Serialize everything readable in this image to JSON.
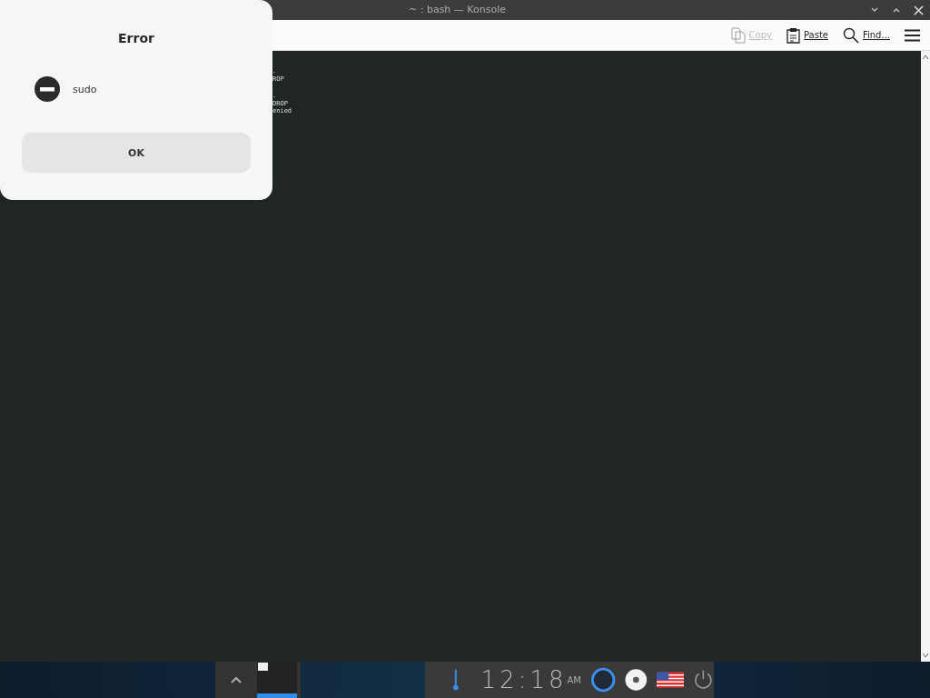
{
  "window": {
    "title": "~ : bash — Konsole"
  },
  "toolbar": [
    {
      "kind": "copy",
      "label": "Copy",
      "disabled": true
    },
    {
      "kind": "paste",
      "label": "Paste",
      "disabled": false
    },
    {
      "kind": "find",
      "label": "Find...",
      "disabled": false
    },
    {
      "kind": "menu"
    }
  ],
  "terminal": {
    "lines": [
      ".",
      "ROP",
      ".",
      "DROP",
      "enied"
    ]
  },
  "dialog": {
    "title": "Error",
    "message": "sudo",
    "button": "OK"
  },
  "taskbar": {
    "clock": {
      "time": "12:18",
      "period": "AM"
    }
  }
}
